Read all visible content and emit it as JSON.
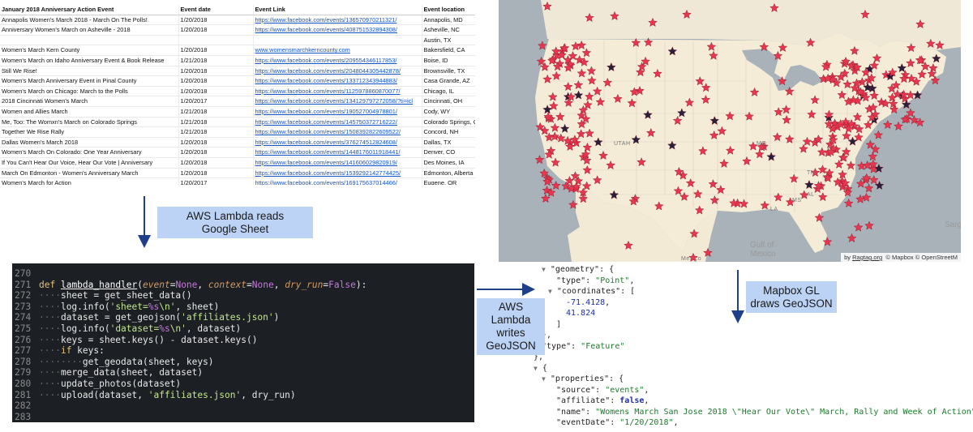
{
  "sheet": {
    "headers": [
      "January 2018 Anniversary Action Event",
      "Event date",
      "Event Link",
      "Event location"
    ],
    "rows": [
      [
        "Annapolis Women's March 2018 - March On The Polls!",
        "1/20/2018",
        "https://www.facebook.com/events/1365709702113​21/",
        "Annapolis, MD"
      ],
      [
        "Anniversary Women's March on Asheville - 2018",
        "1/20/2018",
        "https://www.facebook.com/events/408751532894308/",
        "Asheville, NC"
      ],
      [
        "",
        "",
        "",
        "Austin, TX"
      ],
      [
        "Women's March Kern County",
        "1/20/2018",
        "www.womensmarchkerncounty.com",
        "Bakersfield, CA"
      ],
      [
        "Women's March on Idaho Anniversary Event & Book Release",
        "1/21/2018",
        "https://www.facebook.com/events/209554346117853/",
        "Boise, ID"
      ],
      [
        "Still We Rise!",
        "1/20/2018",
        "https://www.facebook.com/events/2048044305442878/",
        "Brownsville, TX"
      ],
      [
        "Women's March Anniversary Event in Pinal County",
        "1/20/2018",
        "https://www.facebook.com/events/133712343944883/",
        "Casa Grande, AZ"
      ],
      [
        "Women's March on Chicago: March to the Polls",
        "1/20/2018",
        "https://www.facebook.com/events/1125978860870077/",
        "Chicago, IL"
      ],
      [
        "2018 Cincinnati Women's March",
        "1/20/2017",
        "https://www.facebook.com/events/134129797272058/?ti=icl",
        "Cincinnati, OH"
      ],
      [
        "Women and Allies March",
        "1/21/2018",
        "https://www.facebook.com/events/190527004978801/",
        "Cody, WY"
      ],
      [
        "Me, Too: The Womxn's March on Colorado Springs",
        "1/21/2018",
        "https://www.facebook.com/events/145750372716222/",
        "Colorado Springs, C"
      ],
      [
        "Together We Rise Rally",
        "1/21/2018",
        "https://www.facebook.com/events/1508392822609522/",
        "Concord, NH"
      ],
      [
        "Dallas Women's March 2018",
        "1/20/2018",
        "https://www.facebook.com/events/376274512824608/",
        "Dallas, TX"
      ],
      [
        "Women's March On Colorado: One Year Anniversary",
        "1/20/2018",
        "https://www.facebook.com/events/1448176011918441/",
        "Denver, CO"
      ],
      [
        "If You Can't Hear Our Voice, Hear Our Vote | Anniversary",
        "1/20/2018",
        "https://www.facebook.com/events/141606029820919/",
        "Des Moines, IA"
      ],
      [
        "March On Edmonton - Women's Anniversary March",
        "1/20/2018",
        "https://www.facebook.com/events/1539292142774425/",
        "Edmonton, Alberta"
      ],
      [
        "Women's March for Action",
        "1/20/2017",
        "https://www.facebook.com/events/169175637014466/",
        "Eugene, OR"
      ]
    ]
  },
  "map": {
    "land_color": "#f3ead6",
    "water_color": "#a9b2b9",
    "state_labels": [
      "UTAH",
      "MO",
      "TN",
      "AL",
      "LA",
      "MS"
    ],
    "ocean_label": [
      "Gulf of",
      "Mexico"
    ],
    "partial_ocean_label": "Sarga",
    "mexico_label": "Mexico",
    "attribution": {
      "by": "by",
      "link": "Ragtag.org",
      "mapbox": "© Mapbox",
      "osm": "© OpenStreetM"
    },
    "star_color": "#e8364f",
    "star_dark_color": "#2a1f3a"
  },
  "code": {
    "lines": [
      {
        "num": "270",
        "html": ""
      },
      {
        "num": "271",
        "html": "<span class=\"kw\">def</span> <span class=\"fn\">lambda_handler</span>(<span class=\"pa\">event</span>=<span class=\"cn\">None</span>, <span class=\"pa\">context</span>=<span class=\"cn\">None</span>, <span class=\"pa\">dry_run</span>=<span class=\"cn\">False</span>):"
      },
      {
        "num": "272",
        "html": "<span class=\"dim\">····</span>sheet = get_sheet_data()"
      },
      {
        "num": "273",
        "html": "<span class=\"dim\">····</span>log.info(<span class=\"st2\">'sheet=<span class=\"cn\">%s</span>\\n'</span>, sheet)"
      },
      {
        "num": "274",
        "html": "<span class=\"dim\">····</span>dataset = get_geojson(<span class=\"st2\">'affiliates.json'</span>)"
      },
      {
        "num": "275",
        "html": "<span class=\"dim\">····</span>log.info(<span class=\"st2\">'dataset=<span class=\"cn\">%s</span>\\n'</span>, dataset)"
      },
      {
        "num": "276",
        "html": "<span class=\"dim\">····</span>keys = sheet.keys() - dataset.keys()"
      },
      {
        "num": "277",
        "html": "<span class=\"dim\">····</span><span class=\"kw\">if</span> keys:"
      },
      {
        "num": "278",
        "html": "<span class=\"dim\">········</span>get_geodata(sheet, keys)"
      },
      {
        "num": "279",
        "html": "<span class=\"dim\">····</span>merge_data(sheet, dataset)"
      },
      {
        "num": "280",
        "html": "<span class=\"dim\">····</span>update_photos(dataset)"
      },
      {
        "num": "281",
        "html": "<span class=\"dim\">····</span>upload(dataset, <span class=\"st2\">'affiliates.json'</span>, dry_run)"
      },
      {
        "num": "282",
        "html": ""
      },
      {
        "num": "283",
        "html": ""
      }
    ]
  },
  "json_view": {
    "lines": [
      {
        "x": 0,
        "html": "<span class=\"tri\">▼</span> <span class=\"k\">\"geometry\"</span>: {"
      },
      {
        "x": 18,
        "html": "<span class=\"k\">\"type\"</span>: <span class=\"s\">\"Point\"</span>,"
      },
      {
        "x": 8,
        "html": "<span class=\"tri\">▼</span> <span class=\"k\">\"coordinates\"</span>: ["
      },
      {
        "x": 30,
        "html": "<span class=\"n\">-71.4128</span>,"
      },
      {
        "x": 30,
        "html": "<span class=\"n\">41.824</span>"
      },
      {
        "x": 18,
        "html": "]"
      },
      {
        "x": 0,
        "html": "},"
      },
      {
        "x": 0,
        "html": "<span class=\"k\">\"type\"</span>: <span class=\"s\">\"Feature\"</span>"
      },
      {
        "x": -10,
        "html": "},"
      },
      {
        "x": -10,
        "html": "<span class=\"tri\">▼</span> {"
      },
      {
        "x": 0,
        "html": "<span class=\"tri\">▼</span> <span class=\"k\">\"properties\"</span>: {"
      },
      {
        "x": 18,
        "html": "<span class=\"k\">\"source\"</span>: <span class=\"s\">\"events\"</span>,"
      },
      {
        "x": 18,
        "html": "<span class=\"k\">\"affiliate\"</span>: <span class=\"b\">false</span>,"
      },
      {
        "x": 18,
        "html": "<span class=\"k\">\"name\"</span>: <span class=\"s\">\"Womens March San Jose 2018 \\\"Hear Our Vote\\\" March, Rally and Week of Action\"</span>,"
      },
      {
        "x": 18,
        "html": "<span class=\"k\">\"eventDate\"</span>: <span class=\"s\">\"1/20/2018\"</span>,"
      }
    ]
  },
  "callouts": {
    "lambda_reads": "AWS Lambda reads Google Sheet",
    "lambda_writes": "AWS Lambda writes GeoJSON",
    "mapbox_draws": "Mapbox GL draws GeoJSON"
  }
}
